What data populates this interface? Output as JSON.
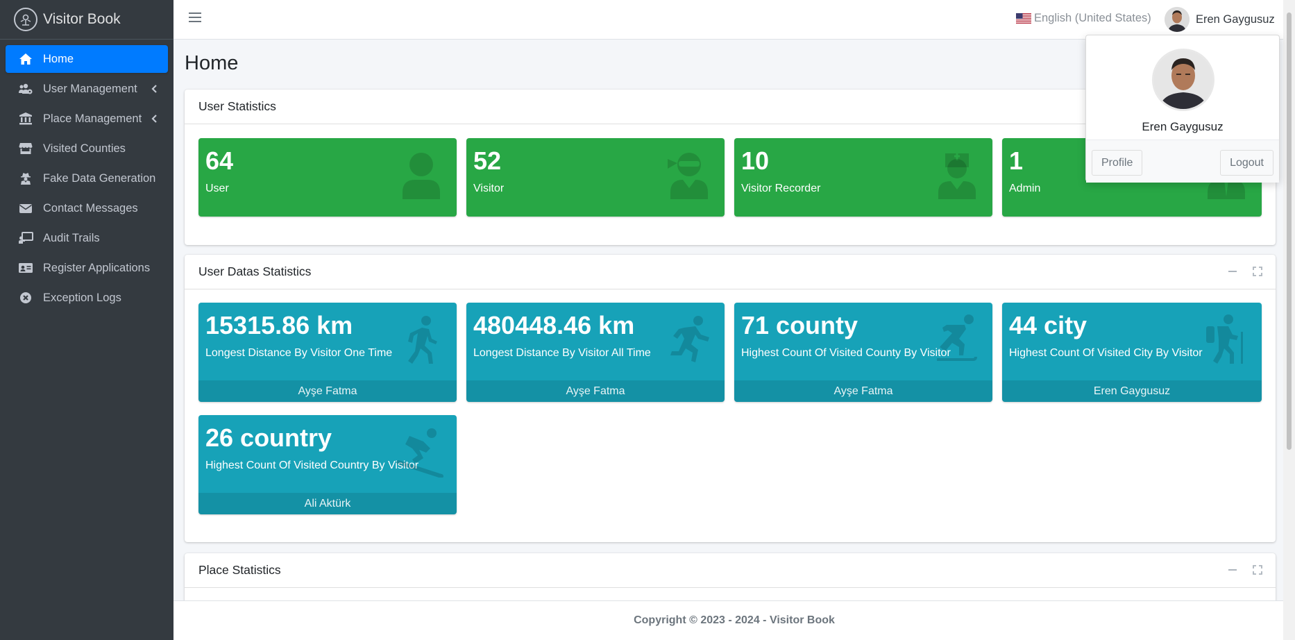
{
  "brand": {
    "name": "Visitor Book"
  },
  "sidebar": {
    "items": [
      {
        "label": "Home",
        "icon": "home-icon",
        "active": true,
        "has_caret": false
      },
      {
        "label": "User Management",
        "icon": "users-cog-icon",
        "active": false,
        "has_caret": true
      },
      {
        "label": "Place Management",
        "icon": "landmark-icon",
        "active": false,
        "has_caret": true
      },
      {
        "label": "Visited Counties",
        "icon": "store-icon",
        "active": false,
        "has_caret": false
      },
      {
        "label": "Fake Data Generation",
        "icon": "user-secret-icon",
        "active": false,
        "has_caret": false
      },
      {
        "label": "Contact Messages",
        "icon": "envelope-icon",
        "active": false,
        "has_caret": false
      },
      {
        "label": "Audit Trails",
        "icon": "chalkboard-teacher-icon",
        "active": false,
        "has_caret": false
      },
      {
        "label": "Register Applications",
        "icon": "id-card-icon",
        "active": false,
        "has_caret": false
      },
      {
        "label": "Exception Logs",
        "icon": "times-circle-icon",
        "active": false,
        "has_caret": false
      }
    ]
  },
  "header": {
    "language": "English (United States)",
    "user_name": "Eren Gaygusuz"
  },
  "page": {
    "title": "Home"
  },
  "user_statistics": {
    "title": "User Statistics",
    "boxes": [
      {
        "value": "64",
        "label": "User",
        "icon": "user-icon"
      },
      {
        "value": "52",
        "label": "Visitor",
        "icon": "user-ninja-icon"
      },
      {
        "value": "10",
        "label": "Visitor Recorder",
        "icon": "user-nurse-icon"
      },
      {
        "value": "1",
        "label": "Admin",
        "icon": "user-tie-icon"
      }
    ]
  },
  "user_datas_statistics": {
    "title": "User Datas Statistics",
    "boxes": [
      {
        "value": "15315.86 km",
        "label": "Longest Distance By Visitor One Time",
        "footer": "Ayşe Fatma",
        "icon": "walking-icon"
      },
      {
        "value": "480448.46 km",
        "label": "Longest Distance By Visitor All Time",
        "footer": "Ayşe Fatma",
        "icon": "running-icon"
      },
      {
        "value": "71 county",
        "label": "Highest Count Of Visited County By Visitor",
        "footer": "Ayşe Fatma",
        "icon": "skating-icon"
      },
      {
        "value": "44 city",
        "label": "Highest Count Of Visited City By Visitor",
        "footer": "Eren Gaygusuz",
        "icon": "hiking-icon"
      },
      {
        "value": "26 country",
        "label": "Highest Count Of Visited Country By Visitor",
        "footer": "Ali Aktürk",
        "icon": "snowboarding-icon"
      }
    ]
  },
  "place_statistics": {
    "title": "Place Statistics"
  },
  "footer": {
    "copyright": "Copyright © 2023 - 2024 - Visitor Book"
  },
  "user_dropdown": {
    "name": "Eren Gaygusuz",
    "profile_label": "Profile",
    "logout_label": "Logout"
  },
  "colors": {
    "accent": "#007bff",
    "success": "#28a745",
    "info": "#17a2b8",
    "sidebar": "#343a40"
  }
}
